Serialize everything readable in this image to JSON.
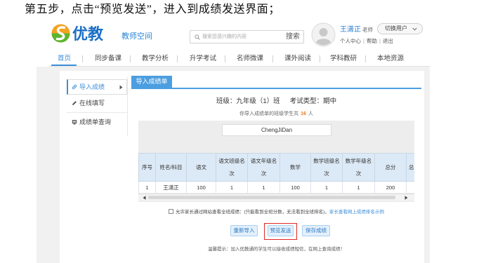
{
  "instruction": "第五步，点击“预览发送”，进入到成绩发送界面；",
  "colors": {
    "accent": "#3d8fd9",
    "tab_bg": "#4b9ee0",
    "highlight": "#e02828",
    "count": "#f07818"
  },
  "header": {
    "logo": {
      "icon": "youjiao-logo-icon",
      "title": "优教",
      "subtitle": "教师空间"
    },
    "search": {
      "icon": "search-icon",
      "placeholder": "搜索您感兴趣的内容",
      "button": "搜索"
    },
    "user": {
      "avatar_icon": "user-avatar-icon",
      "name": "王潇正",
      "role": "老师",
      "links": [
        "个人中心",
        "帮助",
        "退出"
      ]
    },
    "switch_user": {
      "label": "切换用户",
      "icon": "chevron-down-icon"
    }
  },
  "nav": {
    "items": [
      {
        "label": "首页",
        "active": true
      },
      {
        "label": "同步备课",
        "active": false
      },
      {
        "label": "教学分析",
        "active": false
      },
      {
        "label": "升学考试",
        "active": false
      },
      {
        "label": "名师微课",
        "active": false
      },
      {
        "label": "课外阅读",
        "active": false
      },
      {
        "label": "学科教研",
        "active": false
      },
      {
        "label": "本地资源",
        "active": false
      }
    ]
  },
  "sidebar": {
    "items": [
      {
        "label": "导入成绩",
        "icon": "link-icon",
        "active": true,
        "arrow_icon": "caret-right-icon"
      },
      {
        "label": "在线填写",
        "icon": "pencil-icon",
        "active": false
      },
      {
        "label": "成绩单查询",
        "icon": "report-icon",
        "active": false
      }
    ]
  },
  "main": {
    "tab": "导入成绩单",
    "class_info": "班级：九年级（1）班",
    "exam_info": "考试类型：期中",
    "student_count": {
      "prefix": "你导入成绩单的班级学生共",
      "count": 16,
      "suffix": "人"
    },
    "file_name": "ChengJiDan",
    "table": {
      "headers": [
        "序号",
        "姓名/科目",
        "语文",
        "语文班级名次",
        "语文年级名次",
        "数学",
        "数学班级名次",
        "数学年级名次",
        "总分",
        "总"
      ],
      "rows": [
        [
          "1",
          "王潇正",
          "100",
          "1",
          "1",
          "100",
          "1",
          "1",
          "200"
        ]
      ]
    },
    "parent_view": {
      "checked": false,
      "label": "允许家长通过网站查看全班成绩：(只能看到全班分数，无法看到全班排名)，",
      "link": "家长查看网上成绩排名示例"
    },
    "buttons": [
      {
        "label": "重新导入"
      },
      {
        "label": "预览发送",
        "highlighted": true
      },
      {
        "label": "保存成绩"
      }
    ],
    "tip": "温馨提示：加入优教通的学生可以接收成绩短信，在网上查询成绩！"
  }
}
